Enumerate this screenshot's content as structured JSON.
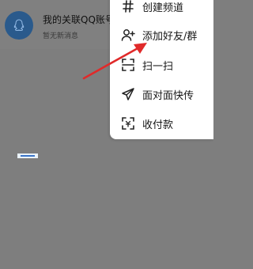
{
  "conversation": {
    "title": "我的关联QQ账号",
    "subtitle": "暂无新消息"
  },
  "menu": {
    "items": [
      {
        "label": "创建频道",
        "icon": "create-channel-icon"
      },
      {
        "label": "添加好友/群",
        "icon": "add-friend-icon"
      },
      {
        "label": "扫一扫",
        "icon": "scan-icon"
      },
      {
        "label": "面对面快传",
        "icon": "send-plane-icon"
      },
      {
        "label": "收付款",
        "icon": "payment-scan-icon"
      }
    ]
  },
  "colors": {
    "overlay": "#7e7e7e",
    "menu_bg": "#ffffff",
    "avatar": "#2a5a8c",
    "arrow": "#e02a2a"
  }
}
